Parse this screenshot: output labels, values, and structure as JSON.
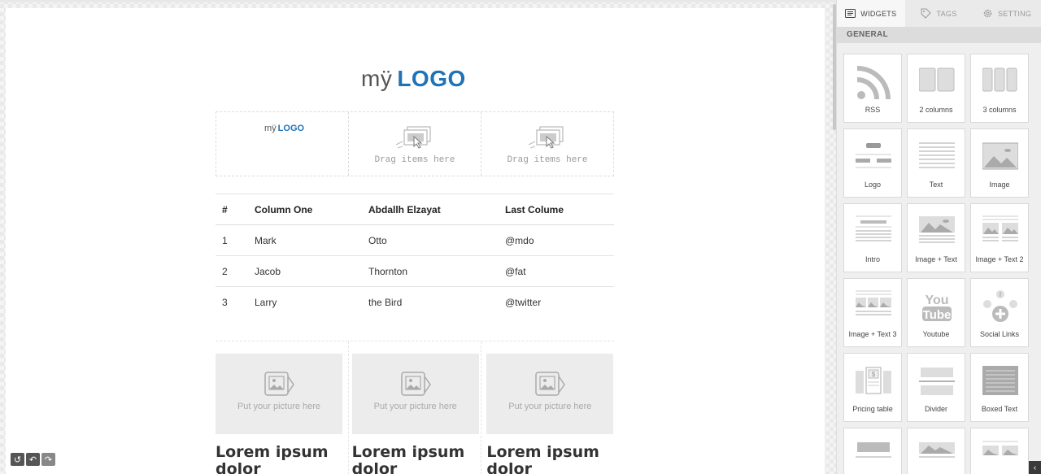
{
  "canvas": {
    "logo": {
      "my": "mÿ",
      "logo": "LOGO"
    },
    "row": {
      "small_logo": {
        "my": "mÿ",
        "logo": "LOGO"
      },
      "drag_text_1": "Drag items here",
      "drag_text_2": "Drag items here"
    },
    "table": {
      "headers": [
        "#",
        "Column One",
        "Abdallh Elzayat",
        "Last Colume"
      ],
      "rows": [
        [
          "1",
          "Mark",
          "Otto",
          "@mdo"
        ],
        [
          "2",
          "Jacob",
          "Thornton",
          "@fat"
        ],
        [
          "3",
          "Larry",
          "the Bird",
          "@twitter"
        ]
      ]
    },
    "pictures": [
      {
        "placeholder": "Put your picture here",
        "heading": "Lorem ipsum dolor"
      },
      {
        "placeholder": "Put your picture here",
        "heading": "Lorem ipsum dolor"
      },
      {
        "placeholder": "Put your picture here",
        "heading": "Lorem ipsum dolor"
      }
    ]
  },
  "history": {
    "icons": [
      "history-icon",
      "undo-icon",
      "redo-icon"
    ]
  },
  "panel": {
    "tabs": [
      {
        "label": "WIDGETS",
        "icon": "widgets-icon",
        "active": true
      },
      {
        "label": "TAGS",
        "icon": "tag-icon",
        "active": false
      },
      {
        "label": "SETTING",
        "icon": "gear-icon",
        "active": false
      }
    ],
    "section": "GENERAL",
    "widgets": [
      {
        "label": "RSS",
        "icon": "rss-icon"
      },
      {
        "label": "2 columns",
        "icon": "two-columns-icon"
      },
      {
        "label": "3 columns",
        "icon": "three-columns-icon"
      },
      {
        "label": "Logo",
        "icon": "logo-icon"
      },
      {
        "label": "Text",
        "icon": "text-icon"
      },
      {
        "label": "Image",
        "icon": "image-icon"
      },
      {
        "label": "Intro",
        "icon": "intro-icon"
      },
      {
        "label": "Image + Text",
        "icon": "image-text-icon"
      },
      {
        "label": "Image + Text 2",
        "icon": "image-text-2-icon"
      },
      {
        "label": "Image + Text 3",
        "icon": "image-text-3-icon"
      },
      {
        "label": "Youtube",
        "icon": "youtube-icon"
      },
      {
        "label": "Social Links",
        "icon": "social-links-icon"
      },
      {
        "label": "Pricing table",
        "icon": "pricing-table-icon"
      },
      {
        "label": "Divider",
        "icon": "divider-icon"
      },
      {
        "label": "Boxed Text",
        "icon": "boxed-text-icon"
      },
      {
        "label": "",
        "icon": "block-icon"
      },
      {
        "label": "",
        "icon": "image-text-icon"
      },
      {
        "label": "",
        "icon": "image-text-2-icon"
      }
    ]
  }
}
